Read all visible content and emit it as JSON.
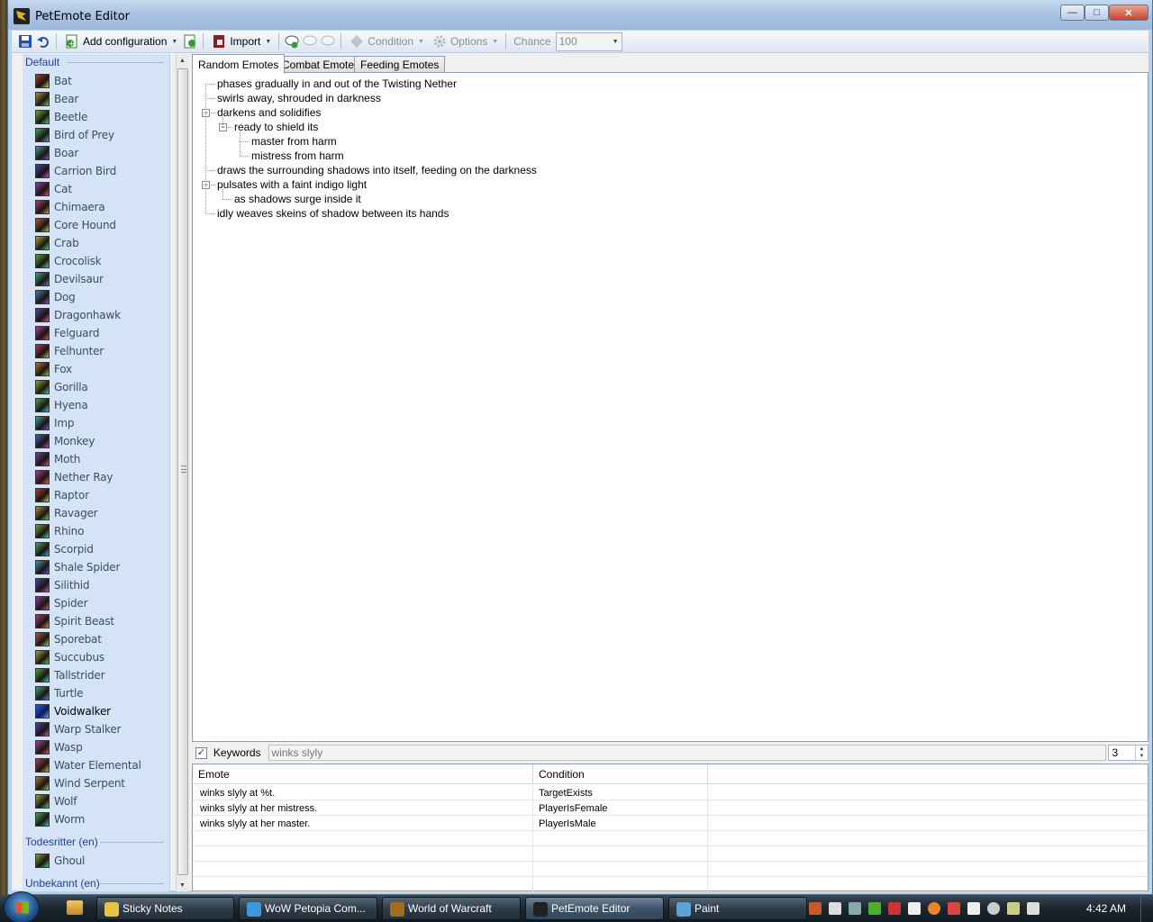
{
  "window": {
    "title": "PetEmote Editor"
  },
  "toolbar": {
    "add_configuration": "Add configuration",
    "import": "Import",
    "condition": "Condition",
    "options": "Options",
    "chance_label": "Chance",
    "chance_value": "100"
  },
  "sidebar": {
    "groups": [
      {
        "name": "Default",
        "items": [
          "Bat",
          "Bear",
          "Beetle",
          "Bird of Prey",
          "Boar",
          "Carrion Bird",
          "Cat",
          "Chimaera",
          "Core Hound",
          "Crab",
          "Crocolisk",
          "Devilsaur",
          "Dog",
          "Dragonhawk",
          "Felguard",
          "Felhunter",
          "Fox",
          "Gorilla",
          "Hyena",
          "Imp",
          "Monkey",
          "Moth",
          "Nether Ray",
          "Raptor",
          "Ravager",
          "Rhino",
          "Scorpid",
          "Shale Spider",
          "Silithid",
          "Spider",
          "Spirit Beast",
          "Sporebat",
          "Succubus",
          "Tallstrider",
          "Turtle",
          "Voidwalker",
          "Warp Stalker",
          "Wasp",
          "Water Elemental",
          "Wind Serpent",
          "Wolf",
          "Worm"
        ]
      },
      {
        "name": "Todesritter (en)",
        "items": [
          "Ghoul"
        ]
      },
      {
        "name": "Unbekannt (en)",
        "items": []
      }
    ],
    "selected": "Voidwalker"
  },
  "tabs": [
    "Random Emotes",
    "Combat Emotes",
    "Feeding Emotes"
  ],
  "active_tab": "Random Emotes",
  "tree": [
    {
      "text": "phases gradually in and out of the Twisting Nether",
      "level": 0
    },
    {
      "text": "swirls away, shrouded in darkness",
      "level": 0
    },
    {
      "text": "darkens and solidifies",
      "level": 0,
      "expanded": true
    },
    {
      "text": "ready to shield its",
      "level": 1,
      "expanded": true
    },
    {
      "text": "master from harm",
      "level": 2
    },
    {
      "text": "mistress from harm",
      "level": 2
    },
    {
      "text": "draws the surrounding shadows into itself, feeding on the darkness",
      "level": 0
    },
    {
      "text": "pulsates with a faint indigo light",
      "level": 0,
      "expanded": true
    },
    {
      "text": "as shadows surge inside it",
      "level": 1
    },
    {
      "text": "idly weaves skeins of shadow between its hands",
      "level": 0
    }
  ],
  "keywords": {
    "label": "Keywords",
    "checked": true,
    "value": "winks slyly",
    "count": "3"
  },
  "grid": {
    "columns": [
      "Emote",
      "Condition"
    ],
    "rows": [
      {
        "emote": "winks slyly at %t.",
        "condition": "TargetExists"
      },
      {
        "emote": "winks slyly at her mistress.",
        "condition": "PlayerIsFemale"
      },
      {
        "emote": "winks slyly at her master.",
        "condition": "PlayerIsMale"
      }
    ]
  },
  "taskbar": {
    "tasks": [
      "Sticky Notes",
      "WoW Petopia Com...",
      "World of Warcraft",
      "PetEmote Editor",
      "Paint"
    ],
    "active": "PetEmote Editor",
    "clock": "4:42 AM"
  },
  "colors": {
    "sidebar_bg": "#d5e3f7",
    "group_header": "#1b3f9c",
    "window_frame": "#b9d1ea"
  }
}
